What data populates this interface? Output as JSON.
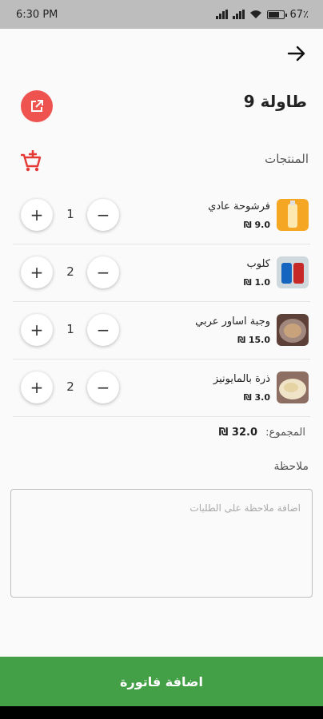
{
  "status_bar": {
    "time": "6:30 PM",
    "battery_percent": "67"
  },
  "header": {
    "table_title": "طاولة 9"
  },
  "products_section": {
    "label": "المنتجات"
  },
  "products": [
    {
      "name": "فرشوحة عادي",
      "price": "9.0 ₪",
      "quantity": "1",
      "image": "drink-bottle"
    },
    {
      "name": "كلوب",
      "price": "1.0 ₪",
      "quantity": "2",
      "image": "soda-can"
    },
    {
      "name": "وجبة اساور عربي",
      "price": "15.0 ₪",
      "quantity": "1",
      "image": "meal-plate"
    },
    {
      "name": "ذرة بالمايونيز",
      "price": "3.0 ₪",
      "quantity": "2",
      "image": "corn-cup"
    }
  ],
  "totals": {
    "label": "المجموع:",
    "value": "32.0 ₪"
  },
  "note": {
    "label": "ملاحظة",
    "placeholder": "اضافة ملاحظة على الطلبات"
  },
  "actions": {
    "submit_label": "اضافة فاتورة"
  },
  "colors": {
    "accent_red": "#ef5350",
    "submit_green": "#43a047",
    "status_bar_bg": "#bdbdbd"
  },
  "icons": {
    "back": "arrow-right-icon",
    "edit": "edit-external-icon",
    "cart": "cart-add-icon"
  }
}
